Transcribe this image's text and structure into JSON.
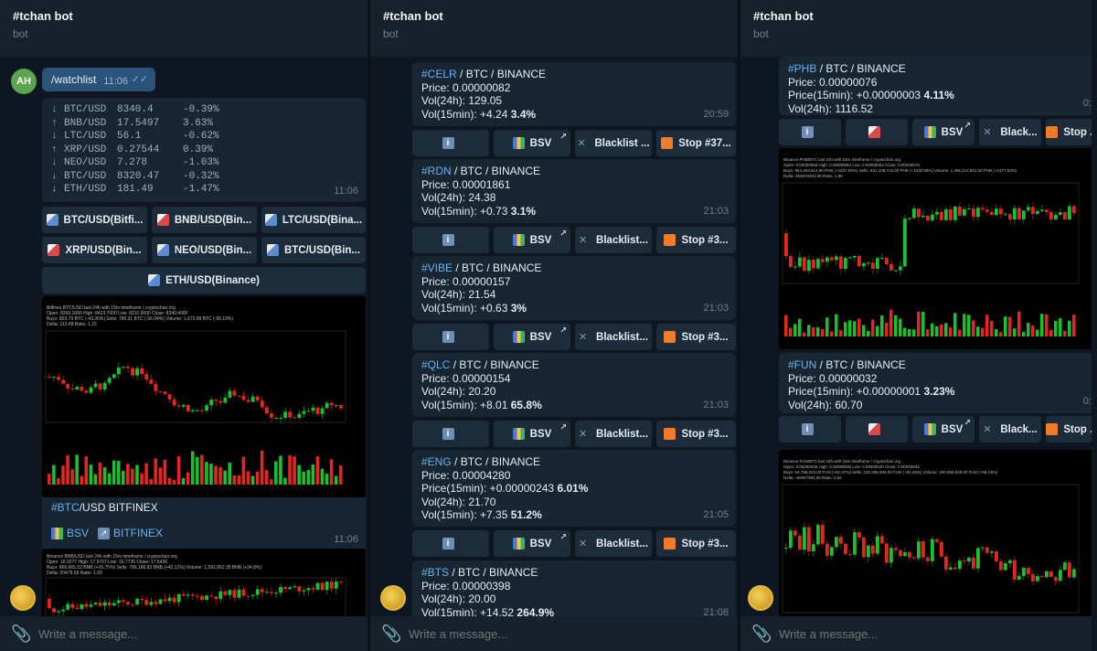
{
  "panels": [
    {
      "title": "#tchan bot",
      "subtitle": "bot",
      "placeholder": "Write a message..."
    },
    {
      "title": "#tchan bot",
      "subtitle": "bot",
      "placeholder": "Write a message..."
    },
    {
      "title": "#tchan bot",
      "subtitle": "bot",
      "placeholder": "Write a message..."
    }
  ],
  "p1": {
    "avatar": "AH",
    "command": "/watchlist",
    "command_time": "11:06",
    "watch": [
      {
        "arrow": "↓",
        "pair": "BTC/USD",
        "price": "8340.4",
        "pct": "-0.39%"
      },
      {
        "arrow": "↑",
        "pair": "BNB/USD",
        "price": "17.5497",
        "pct": "3.63%"
      },
      {
        "arrow": "↓",
        "pair": "LTC/USD",
        "price": "56.1",
        "pct": "-0.62%"
      },
      {
        "arrow": "↑",
        "pair": "XRP/USD",
        "price": "0.27544",
        "pct": "0.39%"
      },
      {
        "arrow": "↓",
        "pair": "NEO/USD",
        "price": "7.278",
        "pct": "-1.03%"
      },
      {
        "arrow": "↓",
        "pair": "BTC/USD",
        "price": "8320.47",
        "pct": "-0.32%"
      },
      {
        "arrow": "↓",
        "pair": "ETH/USD",
        "price": "181.49",
        "pct": "-1.47%"
      }
    ],
    "watch_time": "11:06",
    "buttons": [
      "BTC/USD(Bitfi...",
      "BNB/USD(Bin...",
      "LTC/USD(Bina...",
      "XRP/USD(Bin...",
      "NEO/USD(Bin...",
      "BTC/USD(Bin...",
      "ETH/USD(Binance)"
    ],
    "chart1_title": "Bitfinex BTC/USD last 24h with 15m timeframe / cryptochan.org",
    "chart1_l2": "Open: 8369.1000  High: 8423.7000  Low: 8310.0000  Close: 8340.4000",
    "chart1_l3": "Buys: 803.79 BTC (-43.36%)  Sells: 780.31 BTC (-56.04%)  Volume: 1,673.89 BTC (-56.19%)",
    "chart1_l4": "Delta: 113.48  Ratio: 1.15",
    "caption_tag": "#BTC",
    "caption_rest": "/USD BITFINEX",
    "caption_bsv": "BSV",
    "caption_ex": "BITFINEX",
    "caption_time": "11:06",
    "chart2_title": "Binance BNB/USD last 24h with 15m timeframe / cryptochan.org",
    "chart2_l2": "Open: 16.9277  High: 17.9707  Low: 16.7726  Close: 17.5436",
    "chart2_l3": "Buys: 806,665.52 BNB (+26.75%)  Sells: 786,186.83 BNB (+42.12%)  Volume: 1,592,852.35 BNB (+34.8%)",
    "chart2_l4": "Delta: 20478.69  Ratio: 1.03"
  },
  "p2": {
    "cards": [
      {
        "tag": "#CELR",
        "pair": " / BTC / BINANCE",
        "price": "Price: 0.00000082",
        "l3": "Vol(24h): 129.05",
        "l4": "Vol(15min): +4.24 ",
        "l4b": "3.4%",
        "time": "20:59"
      },
      {
        "tag": "#RDN",
        "pair": " / BTC / BINANCE",
        "price": "Price: 0.00001861",
        "l3": "Vol(24h): 24.38",
        "l4": "Vol(15min): +0.73 ",
        "l4b": "3.1%",
        "time": "21:03"
      },
      {
        "tag": "#VIBE",
        "pair": " / BTC / BINANCE",
        "price": "Price: 0.00000157",
        "l3": "Vol(24h): 21.54",
        "l4": "Vol(15min): +0.63 ",
        "l4b": "3%",
        "time": "21:03"
      },
      {
        "tag": "#QLC",
        "pair": " / BTC / BINANCE",
        "price": "Price: 0.00000154",
        "l3": "Vol(24h): 20.20",
        "l4": "Vol(15min): +8.01 ",
        "l4b": "65.8%",
        "time": "21:03"
      },
      {
        "tag": "#ENG",
        "pair": " / BTC / BINANCE",
        "price": "Price: 0.00004280",
        "l3": "Price(15min): +0.00000243 ",
        "l3b": "6.01%",
        "l4a": "Vol(24h): 21.70",
        "l4": "Vol(15min): +7.35 ",
        "l4b": "51.2%",
        "time": "21:05"
      },
      {
        "tag": "#BTS",
        "pair": " / BTC / BINANCE",
        "price": "Price: 0.00000398",
        "l3": "Vol(24h): 20.00",
        "l4": "Vol(15min): +14.52 ",
        "l4b": "264.9%",
        "time": "21:08"
      }
    ],
    "btn_bsv": "BSV",
    "btn_black_1": "Blacklist ...",
    "btn_black": "Blacklist...",
    "btn_stop_1": "Stop #37...",
    "btn_stop": "Stop #3..."
  },
  "p3": {
    "card1": {
      "tag": "#PHB",
      "pair": " / BTC / BINANCE",
      "price": "Price: 0.00000076",
      "l3": "Price(15min): +0.00000003 ",
      "l3b": "4.11%",
      "l4": "Vol(24h): 1116.52",
      "time": "0:2"
    },
    "card2": {
      "tag": "#FUN",
      "pair": " / BTC / BINANCE",
      "price": "Price: 0.00000032",
      "l3": "Price(15min): +0.00000001 ",
      "l3b": "3.23%",
      "l4": "Vol(24h): 60.70",
      "time": "0:3"
    },
    "btn_bsv": "BSV",
    "btn_black": "Black...",
    "btn_stop": "Stop ...",
    "chart3_title": "Binance PHB/BTC last 24h with 15m timeframe / cryptochan.org",
    "chart3_l2": "Open: 0.00000065  High: 0.00000084  Low: 0.00000062  Close: 0.00000076",
    "chart3_l3": "Buys: 954,283,914.00 PHB (+1537.93%)  Sells: 501,108,715.00 PHB (+1230.68%)  Volume: 1,455,412,621.00 PHB (+2177.63%)",
    "chart3_l4": "Delta: 453075201.00  Ratio: 1.90",
    "chart4_title": "Binance FUN/BTC last 24h with 15m timeframe / cryptochan.org",
    "chart4_l2": "Open: 0.00000036  High: 0.00000036  Low: 0.00000030  Close: 0.00000032",
    "chart4_l3": "Buys: 64,798,023.00 FUN (+81.37%)  Sells: 125,295,606.00 FUN (+91.25%)  Volume: 190,083,629.00 FUN (+95.13%)",
    "chart4_l4": "Delta: -60507583.00  Ratio: 0.52"
  }
}
